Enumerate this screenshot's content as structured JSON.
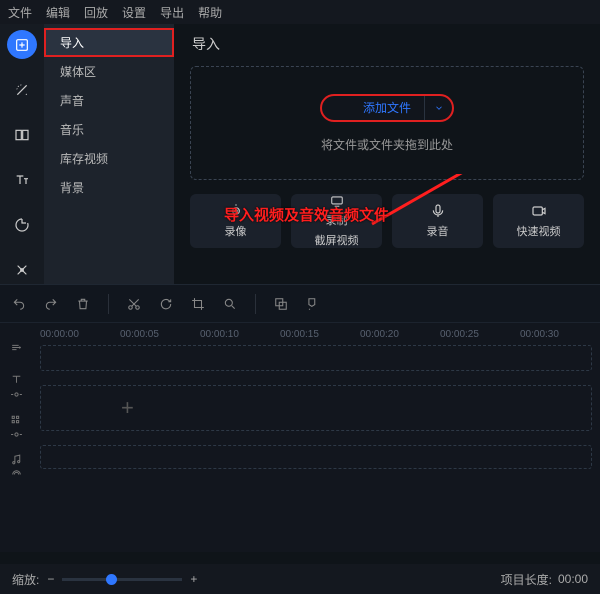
{
  "menubar": [
    "文件",
    "编辑",
    "回放",
    "设置",
    "导出",
    "帮助"
  ],
  "sidebar": {
    "items": [
      "导入",
      "媒体区",
      "声音",
      "音乐",
      "库存视频",
      "背景"
    ],
    "selected_index": 0
  },
  "main": {
    "title": "导入",
    "add_button": "添加文件",
    "drop_hint": "将文件或文件夹拖到此处",
    "annotation": "导入视频及音效音频文件"
  },
  "actions": [
    {
      "label": "录像"
    },
    {
      "label": "录制\n截屏视频",
      "line1": "录制",
      "line2": "截屏视频"
    },
    {
      "label": "录音"
    },
    {
      "label": "快速视频"
    }
  ],
  "ruler": [
    "00:00:00",
    "00:00:05",
    "00:00:10",
    "00:00:15",
    "00:00:20",
    "00:00:25",
    "00:00:30"
  ],
  "footer": {
    "zoom_label": "缩放:",
    "duration_label": "项目长度:",
    "duration_value": "00:00"
  }
}
